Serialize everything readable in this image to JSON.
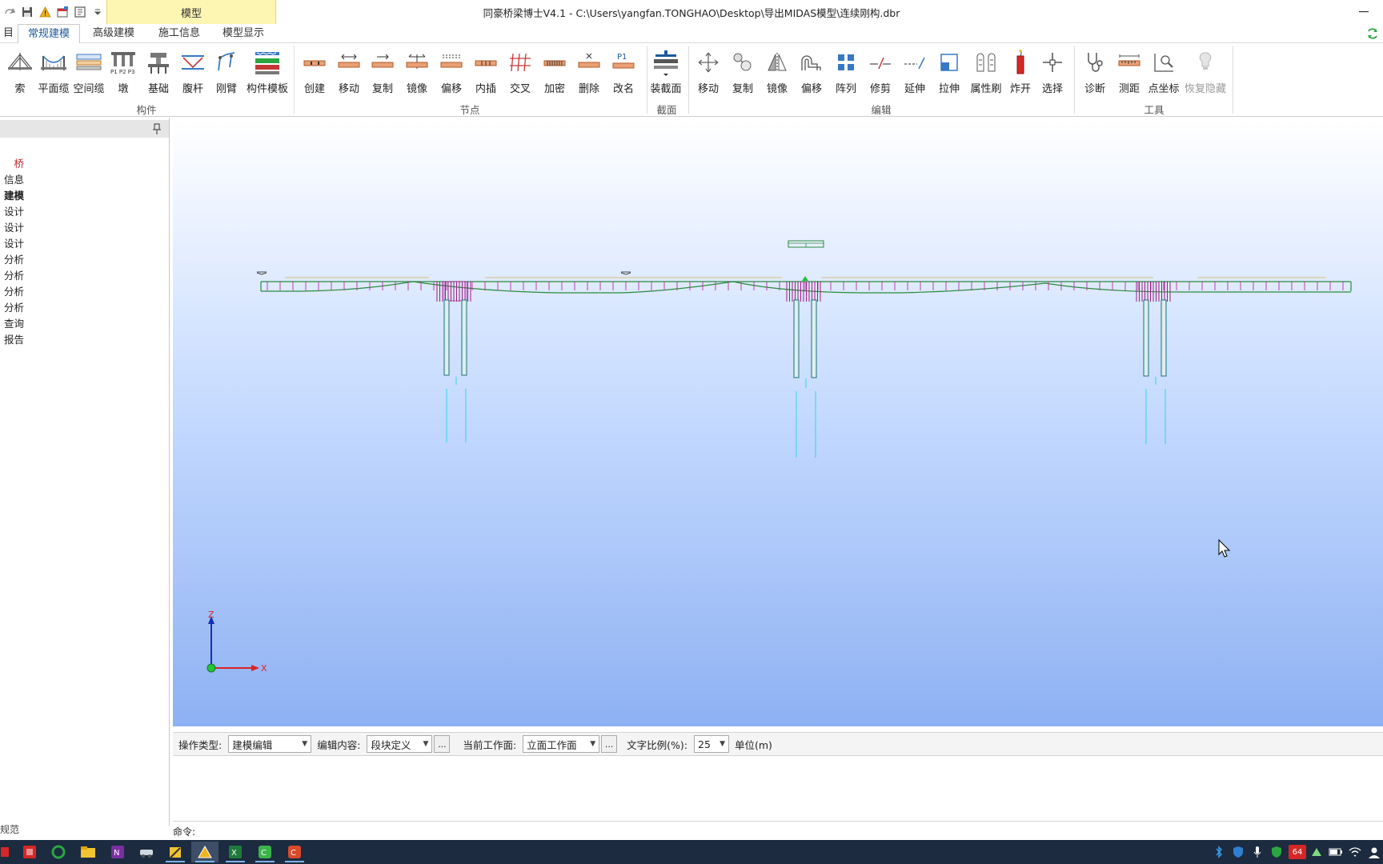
{
  "window": {
    "title": "同豪桥梁博士V4.1 - C:\\Users\\yangfan.TONGHAO\\Desktop\\导出MIDAS模型\\连续刚构.dbr",
    "context_tab": "模型"
  },
  "tabs": [
    {
      "label": "目",
      "active": false
    },
    {
      "label": "常规建模",
      "active": true
    },
    {
      "label": "高级建模",
      "active": false
    },
    {
      "label": "施工信息",
      "active": false
    },
    {
      "label": "模型显示",
      "active": false
    }
  ],
  "ribbon": {
    "groups": [
      {
        "label": "构件",
        "buttons": [
          "索",
          "平面缆",
          "空间缆",
          "墩",
          "基础",
          "腹杆",
          "刚臂",
          "构件模板"
        ]
      },
      {
        "label": "节点",
        "buttons": [
          "创建",
          "移动",
          "复制",
          "镜像",
          "偏移",
          "内插",
          "交叉",
          "加密",
          "删除",
          "改名"
        ]
      },
      {
        "label": "截面",
        "buttons": [
          "装截面"
        ]
      },
      {
        "label": "编辑",
        "buttons": [
          "移动",
          "复制",
          "镜像",
          "偏移",
          "阵列",
          "修剪",
          "延伸",
          "拉伸",
          "属性刷",
          "炸开",
          "选择"
        ]
      },
      {
        "label": "工具",
        "buttons": [
          "诊断",
          "测距",
          "点坐标",
          "恢复隐藏"
        ]
      }
    ],
    "icon_texts": {
      "p1p2p3": "P1 P2 P3",
      "p1": "P1"
    }
  },
  "tree": {
    "items": [
      {
        "label": "桥",
        "style": "red"
      },
      {
        "label": "信息",
        "style": "normal"
      },
      {
        "label": "建模",
        "style": "bold"
      },
      {
        "label": "设计",
        "style": "normal"
      },
      {
        "label": "设计",
        "style": "normal"
      },
      {
        "label": "设计",
        "style": "normal"
      },
      {
        "label": "分析",
        "style": "normal"
      },
      {
        "label": "分析",
        "style": "normal"
      },
      {
        "label": "分析",
        "style": "normal"
      },
      {
        "label": "分析",
        "style": "normal"
      },
      {
        "label": "查询",
        "style": "normal"
      },
      {
        "label": "报告",
        "style": "normal"
      }
    ],
    "footer": "规范"
  },
  "viewport": {
    "axis_x": "X",
    "axis_z": "Z"
  },
  "op_bar": {
    "op_type_label": "操作类型:",
    "op_type_value": "建模编辑",
    "edit_content_label": "编辑内容:",
    "edit_content_value": "段块定义",
    "workplane_label": "当前工作面:",
    "workplane_value": "立面工作面",
    "text_scale_label": "文字比例(%):",
    "text_scale_value": "25",
    "unit": "单位(m)",
    "dots": "..."
  },
  "command": {
    "label": "命令:",
    "value": ""
  },
  "taskbar": {
    "tray_badge": "64"
  },
  "colors": {
    "deck_pink": "#c02aa8",
    "deck_green": "#2a8a3c",
    "pier_teal": "#1f6e7a",
    "pile_cyan": "#2fd6e8",
    "axis_red": "#d9232a",
    "axis_blue": "#1430b8",
    "accent_tab": "#fdf6b3"
  }
}
